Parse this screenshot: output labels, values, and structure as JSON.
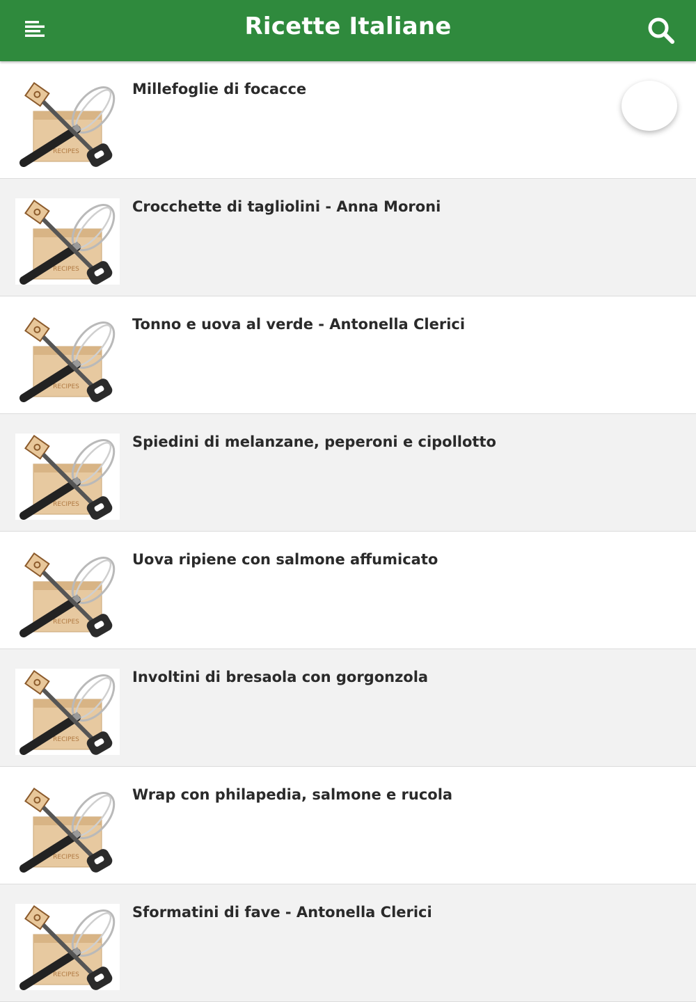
{
  "header": {
    "title": "Ricette Italiane",
    "menu_icon": "menu-icon",
    "search_icon": "search-icon",
    "bar_color": "#2f8a3d"
  },
  "recipes": [
    {
      "title": "Millefoglie di focacce",
      "thumb_label": "RECIPES"
    },
    {
      "title": "Crocchette di tagliolini - Anna Moroni",
      "thumb_label": "RECIPES"
    },
    {
      "title": "Tonno e uova al verde - Antonella Clerici",
      "thumb_label": "RECIPES"
    },
    {
      "title": "Spiedini di melanzane, peperoni e cipollotto",
      "thumb_label": "RECIPES"
    },
    {
      "title": "Uova ripiene con salmone affumicato",
      "thumb_label": "RECIPES"
    },
    {
      "title": "Involtini di bresaola con gorgonzola",
      "thumb_label": "RECIPES"
    },
    {
      "title": "Wrap con philapedia, salmone e rucola",
      "thumb_label": "RECIPES"
    },
    {
      "title": "Sformatini di fave - Antonella Clerici",
      "thumb_label": "RECIPES"
    }
  ]
}
